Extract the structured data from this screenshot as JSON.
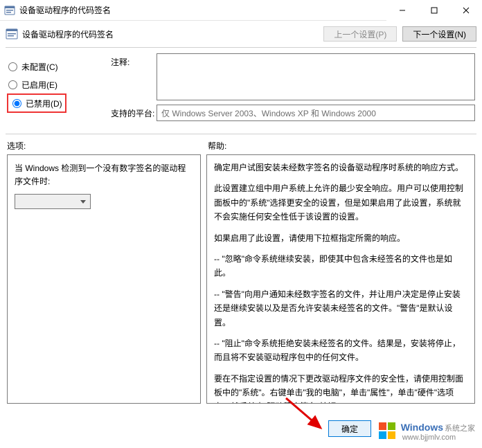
{
  "window": {
    "title": "设备驱动程序的代码签名"
  },
  "toolbar": {
    "label": "设备驱动程序的代码签名",
    "prev_button": "上一个设置(P)",
    "next_button": "下一个设置(N)"
  },
  "radios": {
    "not_configured": "未配置(C)",
    "enabled": "已启用(E)",
    "disabled": "已禁用(D)"
  },
  "fields": {
    "comment_label": "注释:",
    "comment_value": "",
    "platforms_label": "支持的平台:",
    "platforms_value": "仅 Windows Server 2003、Windows XP 和 Windows 2000"
  },
  "sections": {
    "options_label": "选项:",
    "help_label": "帮助:"
  },
  "options": {
    "text": "当 Windows 检测到一个没有数字签名的驱动程序文件时:",
    "dropdown_value": ""
  },
  "help": {
    "p1": "确定用户试图安装未经数字签名的设备驱动程序时系统的响应方式。",
    "p2": "此设置建立组中用户系统上允许的最少安全响应。用户可以使用控制面板中的\"系统\"选择更安全的设置，但是如果启用了此设置，系统就不会实施任何安全性低于该设置的设置。",
    "p3": "如果启用了此设置，请使用下拉框指定所需的响应。",
    "p4": "-- \"忽略\"命令系统继续安装，即使其中包含未经签名的文件也是如此。",
    "p5": "-- \"警告\"向用户通知未经数字签名的文件，并让用户决定是停止安装还是继续安装以及是否允许安装未经签名的文件。\"警告\"是默认设置。",
    "p6": "-- \"阻止\"命令系统拒绝安装未经签名的文件。结果是，安装将停止，而且将不安装驱动程序包中的任何文件。",
    "p7": "要在不指定设置的情况下更改驱动程序文件的安全性，请使用控制面板中的\"系统\"。右键单击\"我的电脑\"，单击\"属性\"，单击\"硬件\"选项卡，然后单击\"驱动程序签名\"按钮。"
  },
  "buttons": {
    "ok": "确定"
  },
  "watermark": {
    "title": "Windows",
    "subtitle": "系统之家",
    "url": "www.bjjmlv.com"
  }
}
